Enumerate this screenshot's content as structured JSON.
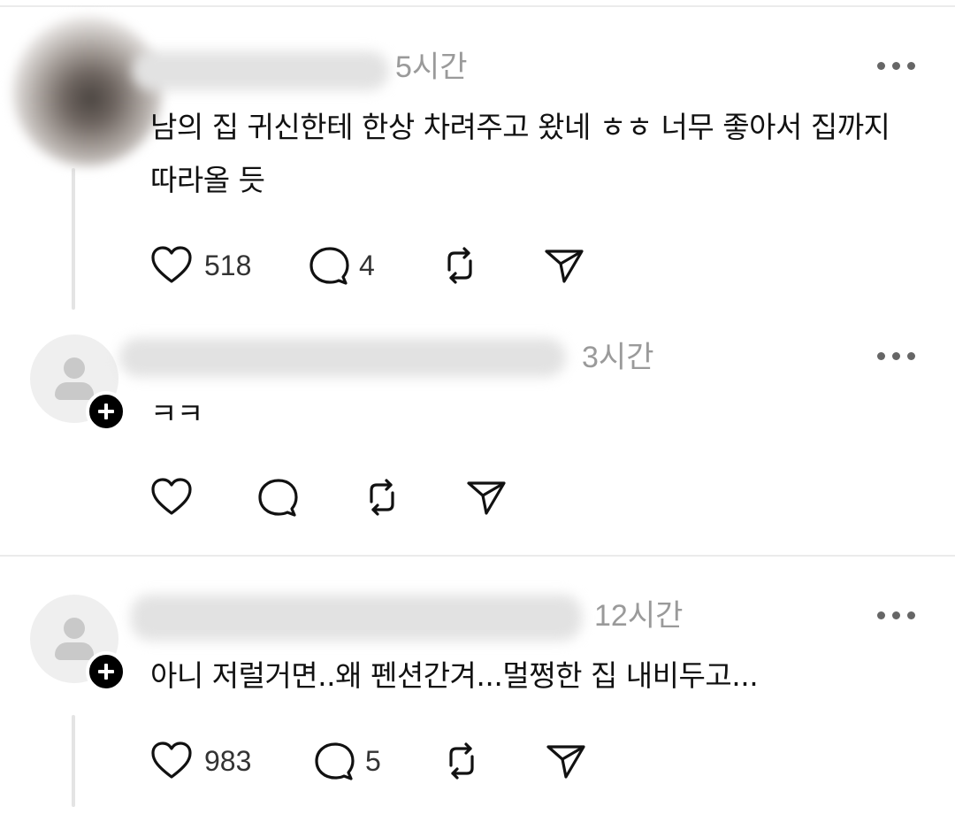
{
  "comments": [
    {
      "time": "5시간",
      "text_line1": "남의 집 귀신한테 한상 차려주고 왔네 ㅎㅎ 너무 좋아서 집까지",
      "text_line2": "따라올 듯",
      "likes": "518",
      "replies": "4"
    },
    {
      "time": "3시간",
      "text_line1": "ㅋㅋ",
      "likes": "",
      "replies": ""
    },
    {
      "time": "12시간",
      "text_line1": "아니 저럴거면..왜 펜션간겨...멀쩡한 집 내비두고...",
      "likes": "983",
      "replies": "5"
    }
  ],
  "icons": {
    "like": "heart-icon",
    "reply": "comment-bubble-icon",
    "repost": "repost-icon",
    "share": "send-icon",
    "more": "more-options-icon",
    "follow": "plus-icon"
  },
  "colors": {
    "text": "#111111",
    "muted": "#9a9a9a",
    "divider": "#ebebeb",
    "badge": "#000000"
  }
}
